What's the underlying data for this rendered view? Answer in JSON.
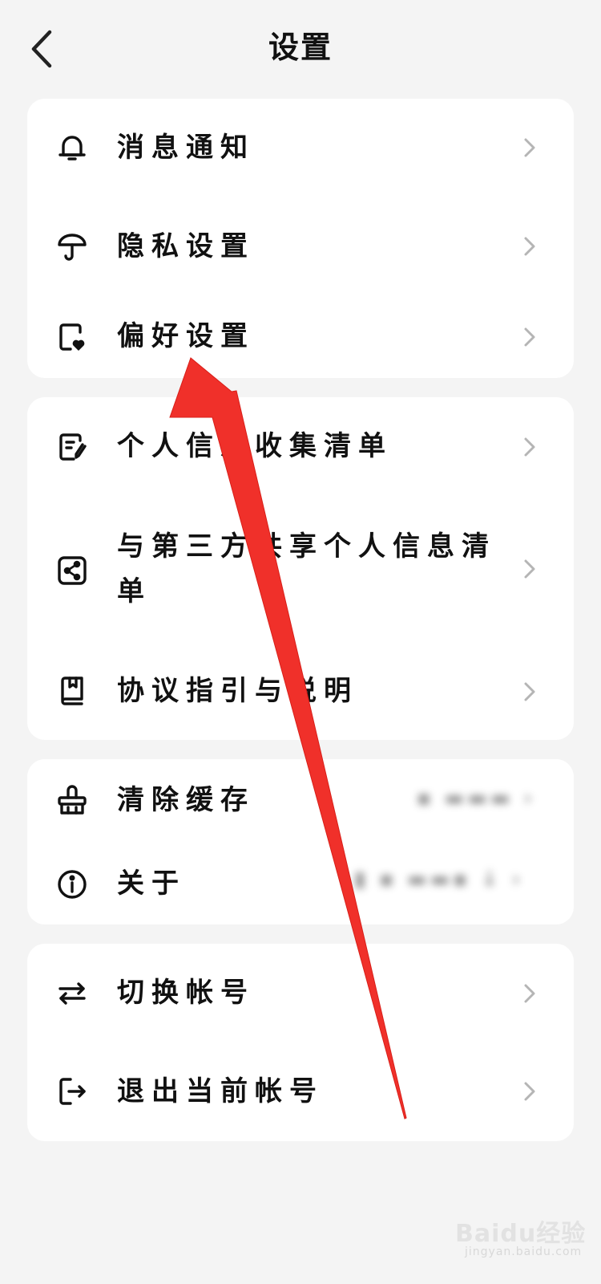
{
  "header": {
    "title": "设置"
  },
  "groups": [
    {
      "items": [
        {
          "label": "消息通知",
          "icon": "bell-icon"
        },
        {
          "label": "隐私设置",
          "icon": "umbrella-icon"
        },
        {
          "label": "偏好设置",
          "icon": "heart-card-icon"
        }
      ]
    },
    {
      "items": [
        {
          "label": "个人信息收集清单",
          "icon": "list-edit-icon"
        },
        {
          "label": "与第三方共享个人信息清单",
          "icon": "share-icon"
        },
        {
          "label": "协议指引与说明",
          "icon": "book-icon"
        }
      ]
    },
    {
      "items": [
        {
          "label": "清除缓存",
          "icon": "broom-icon"
        },
        {
          "label": "关于",
          "icon": "info-icon"
        }
      ]
    },
    {
      "items": [
        {
          "label": "切换帐号",
          "icon": "swap-icon"
        },
        {
          "label": "退出当前帐号",
          "icon": "logout-icon"
        }
      ]
    }
  ],
  "watermark": {
    "logo": "Baidu经验",
    "url": "jingyan.baidu.com"
  },
  "colors": {
    "background": "#f4f4f4",
    "card": "#ffffff",
    "annotation_arrow": "#f0302a",
    "chevron": "#b5b5b5"
  }
}
